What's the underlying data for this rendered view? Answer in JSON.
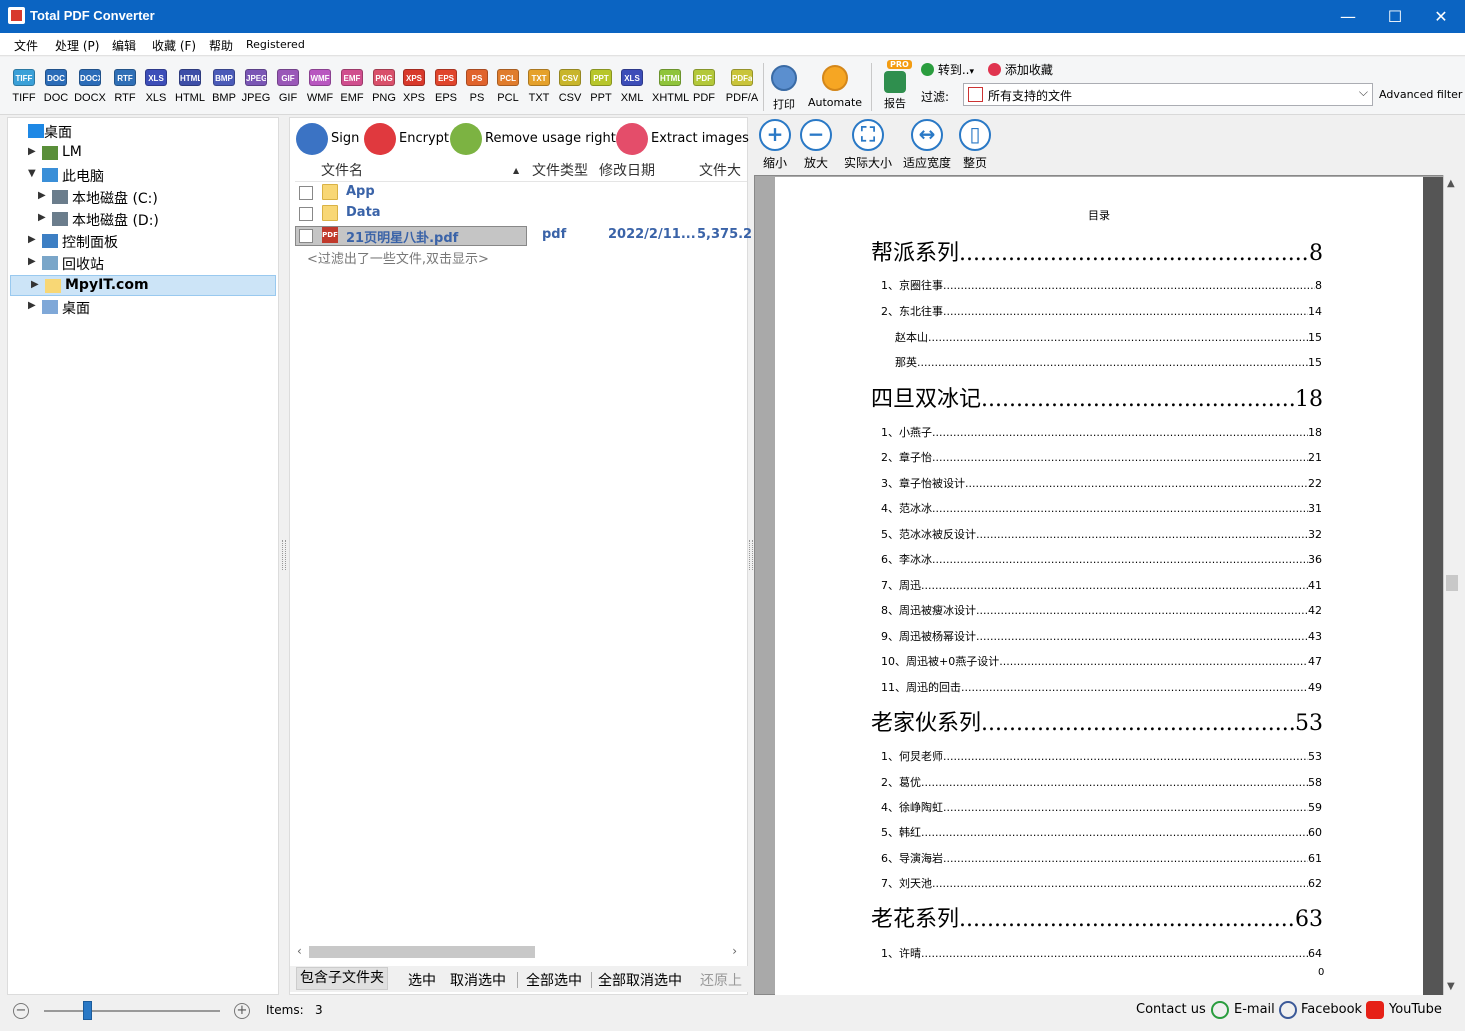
{
  "window": {
    "title": "Total PDF Converter",
    "minimize_glyph": "—",
    "maximize_glyph": "☐",
    "close_glyph": "✕"
  },
  "menu": [
    "文件",
    "处理 (P)",
    "编辑",
    "收藏 (F)",
    "帮助",
    "Registered"
  ],
  "formats": [
    {
      "icon": "TIFF",
      "label": "TIFF",
      "color": "#3aa0d8"
    },
    {
      "icon": "DOC",
      "label": "DOC",
      "color": "#2b6cb8"
    },
    {
      "icon": "DOCX",
      "label": "DOCX",
      "color": "#2b6cb8"
    },
    {
      "icon": "RTF",
      "label": "RTF",
      "color": "#2f6fb6"
    },
    {
      "icon": "XLS",
      "label": "XLS",
      "color": "#3c4db8"
    },
    {
      "icon": "HTML",
      "label": "HTML",
      "color": "#3d4ea7"
    },
    {
      "icon": "BMP",
      "label": "BMP",
      "color": "#4b5bb8"
    },
    {
      "icon": "JPEG",
      "label": "JPEG",
      "color": "#7a56b5"
    },
    {
      "icon": "GIF",
      "label": "GIF",
      "color": "#9a58b8"
    },
    {
      "icon": "WMF",
      "label": "WMF",
      "color": "#b856c0"
    },
    {
      "icon": "EMF",
      "label": "EMF",
      "color": "#d04e8e"
    },
    {
      "icon": "PNG",
      "label": "PNG",
      "color": "#d9506b"
    },
    {
      "icon": "XPS",
      "label": "XPS",
      "color": "#d8392b"
    },
    {
      "icon": "EPS",
      "label": "EPS",
      "color": "#e0452c"
    },
    {
      "icon": "PS",
      "label": "PS",
      "color": "#e0632c"
    },
    {
      "icon": "PCL",
      "label": "PCL",
      "color": "#e07c2c"
    },
    {
      "icon": "TXT",
      "label": "TXT",
      "color": "#e5a12b"
    },
    {
      "icon": "CSV",
      "label": "CSV",
      "color": "#c8b52b"
    },
    {
      "icon": "PPT",
      "label": "PPT",
      "color": "#b7c62b"
    },
    {
      "icon": "XLS",
      "label": "XML",
      "color": "#3c4db8"
    },
    {
      "icon": "HTML",
      "label": "XHTML",
      "color": "#8fc43b"
    },
    {
      "icon": "PDF",
      "label": "PDF",
      "color": "#b3c83a"
    },
    {
      "icon": "PDFa",
      "label": "PDF/A",
      "color": "#c9c43a"
    }
  ],
  "toolbar": {
    "print_label": "打印",
    "automate_label": "Automate",
    "pro_badge": "PRO",
    "report_label": "报告",
    "goto_label": "转到..",
    "goto_caret": "▾",
    "favorite_label": "添加收藏",
    "filter_label": "过滤:",
    "filter_value": "所有支持的文件",
    "filter_caret": "⌵",
    "advanced_filter": "Advanced filter"
  },
  "tree": [
    {
      "label": "桌面",
      "arrow": "",
      "indent": 0,
      "icon": "desktop-icon",
      "color": "#1e88e5",
      "selected": false
    },
    {
      "label": "LM",
      "arrow": "▶",
      "indent": 1,
      "icon": "user-icon",
      "color": "#5a8f3a",
      "selected": false
    },
    {
      "label": "此电脑",
      "arrow": "▼",
      "indent": 1,
      "icon": "computer-icon",
      "color": "#3a8fd8",
      "selected": false
    },
    {
      "label": "本地磁盘 (C:)",
      "arrow": "▶",
      "indent": 2,
      "icon": "drive-c-icon",
      "color": "#6b7d8c",
      "selected": false
    },
    {
      "label": "本地磁盘 (D:)",
      "arrow": "▶",
      "indent": 2,
      "icon": "drive-d-icon",
      "color": "#6b7d8c",
      "selected": false
    },
    {
      "label": "控制面板",
      "arrow": "▶",
      "indent": 1,
      "icon": "control-panel-icon",
      "color": "#3d7fc4",
      "selected": false
    },
    {
      "label": "回收站",
      "arrow": "▶",
      "indent": 1,
      "icon": "recycle-bin-icon",
      "color": "#7aa6c9",
      "selected": false
    },
    {
      "label": "MpyIT.com",
      "arrow": "▶",
      "indent": 1,
      "icon": "folder-icon",
      "color": "#f8d775",
      "selected": true
    },
    {
      "label": "桌面",
      "arrow": "▶",
      "indent": 1,
      "icon": "desktop-folder-icon",
      "color": "#7fa8d8",
      "selected": false
    }
  ],
  "actions": {
    "sign": "Sign",
    "encrypt": "Encrypt",
    "remove_rights": "Remove usage rights",
    "extract_images": "Extract images"
  },
  "columns": {
    "name": "文件名",
    "sort_glyph": "▲",
    "type": "文件类型",
    "date": "修改日期",
    "size": "文件大"
  },
  "files": [
    {
      "name": "App",
      "type": "",
      "date": "",
      "size": "",
      "kind": "folder"
    },
    {
      "name": "Data",
      "type": "",
      "date": "",
      "size": "",
      "kind": "folder"
    },
    {
      "name": "21页明星八卦.pdf",
      "type": "pdf",
      "date": "2022/2/11...",
      "size": "5,375.2",
      "kind": "pdf"
    }
  ],
  "pdf_icon_text": "PDF",
  "filter_note": "<过滤出了一些文件,双击显示>",
  "hscroll": {
    "left": "‹",
    "right": "›"
  },
  "bottom_links": {
    "include_subfolders": "包含子文件夹",
    "select": "选中",
    "deselect": "取消选中",
    "select_all": "全部选中",
    "deselect_all": "全部取消选中",
    "restore": "还原上"
  },
  "preview_tools": [
    {
      "icon": "zoom-in-icon",
      "glyph": "+",
      "label": "缩小"
    },
    {
      "icon": "zoom-out-icon",
      "glyph": "−",
      "label": "放大"
    },
    {
      "icon": "actual-size-icon",
      "glyph": "⛶",
      "label": "实际大小"
    },
    {
      "icon": "fit-width-icon",
      "glyph": "↔",
      "label": "适应宽度"
    },
    {
      "icon": "whole-page-icon",
      "glyph": "▯",
      "label": "整页"
    }
  ],
  "vscroll": {
    "up": "▲",
    "down": "▼"
  },
  "toc": {
    "title": "目录",
    "entries": [
      {
        "kind": "h",
        "text": "帮派系列",
        "page": "8"
      },
      {
        "kind": "i",
        "text": "1、京圈往事",
        "page": "8",
        "indent": 0
      },
      {
        "kind": "i",
        "text": "2、东北往事",
        "page": "14",
        "indent": 0
      },
      {
        "kind": "i",
        "text": "赵本山",
        "page": "15",
        "indent": 1
      },
      {
        "kind": "i",
        "text": "那英",
        "page": "15",
        "indent": 1
      },
      {
        "kind": "h",
        "text": "四旦双冰记",
        "page": "18"
      },
      {
        "kind": "i",
        "text": "1、小燕子",
        "page": "18",
        "indent": 0
      },
      {
        "kind": "i",
        "text": "2、章子怡",
        "page": "21",
        "indent": 0
      },
      {
        "kind": "i",
        "text": "3、章子怡被设计",
        "page": "22",
        "indent": 0
      },
      {
        "kind": "i",
        "text": "4、范冰冰",
        "page": "31",
        "indent": 0
      },
      {
        "kind": "i",
        "text": "5、范冰冰被反设计",
        "page": "32",
        "indent": 0
      },
      {
        "kind": "i",
        "text": "6、李冰冰",
        "page": "36",
        "indent": 0
      },
      {
        "kind": "i",
        "text": "7、周迅",
        "page": "41",
        "indent": 0
      },
      {
        "kind": "i",
        "text": "8、周迅被瘦冰设计",
        "page": "42",
        "indent": 0
      },
      {
        "kind": "i",
        "text": "9、周迅被杨幂设计",
        "page": "43",
        "indent": 0
      },
      {
        "kind": "i",
        "text": "10、周迅被+0燕子设计",
        "page": "47",
        "indent": 0
      },
      {
        "kind": "i",
        "text": "11、周迅的回击",
        "page": "49",
        "indent": 0
      },
      {
        "kind": "h",
        "text": "老家伙系列",
        "page": "53"
      },
      {
        "kind": "i",
        "text": "1、何炅老师",
        "page": "53",
        "indent": 0
      },
      {
        "kind": "i",
        "text": "2、葛优",
        "page": "58",
        "indent": 0
      },
      {
        "kind": "i",
        "text": "4、徐峥陶虹",
        "page": "59",
        "indent": 0
      },
      {
        "kind": "i",
        "text": "5、韩红",
        "page": "60",
        "indent": 0
      },
      {
        "kind": "i",
        "text": "6、导演海岩",
        "page": "61",
        "indent": 0
      },
      {
        "kind": "i",
        "text": "7、刘天池",
        "page": "62",
        "indent": 0
      },
      {
        "kind": "h",
        "text": "老花系列",
        "page": "63"
      },
      {
        "kind": "i",
        "text": "1、许晴",
        "page": "64",
        "indent": 0
      }
    ],
    "page_number": "0"
  },
  "status": {
    "zoom_minus": "−",
    "zoom_plus": "+",
    "items_label": "Items:",
    "items_count": "3",
    "contact": "Contact us",
    "email": "E-mail",
    "facebook": "Facebook",
    "youtube": "YouTube"
  }
}
